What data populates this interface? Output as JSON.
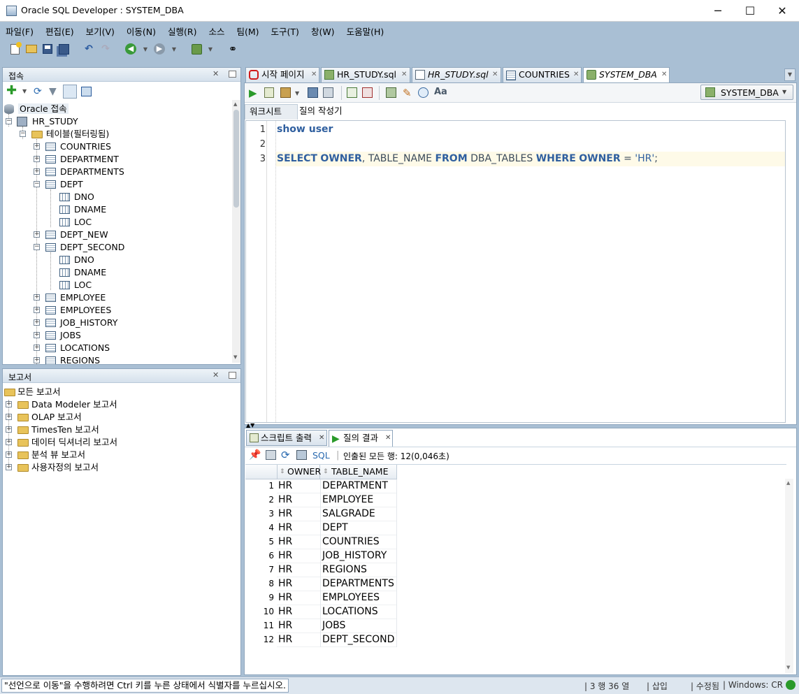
{
  "window": {
    "title": "Oracle SQL Developer : SYSTEM_DBA",
    "controls": {
      "minimize": "─",
      "maximize": "☐",
      "close": "✕"
    }
  },
  "menu": [
    "파일(F)",
    "편집(E)",
    "보기(V)",
    "이동(N)",
    "실행(R)",
    "소스",
    "팀(M)",
    "도구(T)",
    "창(W)",
    "도움말(H)"
  ],
  "connections_panel": {
    "title": "접속",
    "tree": [
      {
        "label": "Oracle 접속",
        "level": 0,
        "kind": "root"
      },
      {
        "label": "HR_STUDY",
        "level": 1,
        "kind": "connection",
        "expanded": true
      },
      {
        "label": "테이블(필터링됨)",
        "level": 2,
        "kind": "folder",
        "expanded": true
      },
      {
        "label": "COUNTRIES",
        "level": 3,
        "kind": "table"
      },
      {
        "label": "DEPARTMENT",
        "level": 3,
        "kind": "table"
      },
      {
        "label": "DEPARTMENTS",
        "level": 3,
        "kind": "table"
      },
      {
        "label": "DEPT",
        "level": 3,
        "kind": "table",
        "expanded": true
      },
      {
        "label": "DNO",
        "level": 4,
        "kind": "column"
      },
      {
        "label": "DNAME",
        "level": 4,
        "kind": "column"
      },
      {
        "label": "LOC",
        "level": 4,
        "kind": "column"
      },
      {
        "label": "DEPT_NEW",
        "level": 3,
        "kind": "table"
      },
      {
        "label": "DEPT_SECOND",
        "level": 3,
        "kind": "table",
        "expanded": true
      },
      {
        "label": "DNO",
        "level": 4,
        "kind": "column"
      },
      {
        "label": "DNAME",
        "level": 4,
        "kind": "column"
      },
      {
        "label": "LOC",
        "level": 4,
        "kind": "column"
      },
      {
        "label": "EMPLOYEE",
        "level": 3,
        "kind": "table"
      },
      {
        "label": "EMPLOYEES",
        "level": 3,
        "kind": "table"
      },
      {
        "label": "JOB_HISTORY",
        "level": 3,
        "kind": "table"
      },
      {
        "label": "JOBS",
        "level": 3,
        "kind": "table"
      },
      {
        "label": "LOCATIONS",
        "level": 3,
        "kind": "table"
      },
      {
        "label": "REGIONS",
        "level": 3,
        "kind": "table"
      }
    ]
  },
  "reports_panel": {
    "title": "보고서",
    "items": [
      {
        "label": "모든 보고서",
        "level": 0
      },
      {
        "label": "Data Modeler 보고서",
        "level": 1
      },
      {
        "label": "OLAP 보고서",
        "level": 1
      },
      {
        "label": "TimesTen 보고서",
        "level": 1
      },
      {
        "label": "데이터 딕셔너리 보고서",
        "level": 1
      },
      {
        "label": "분석 뷰 보고서",
        "level": 1
      },
      {
        "label": "사용자정의 보고서",
        "level": 1
      }
    ]
  },
  "editor_tabs": [
    {
      "label": "시작 페이지",
      "italic": false,
      "active": false
    },
    {
      "label": "HR_STUDY.sql",
      "italic": false,
      "active": false
    },
    {
      "label": "HR_STUDY.sql",
      "italic": true,
      "active": false
    },
    {
      "label": "COUNTRIES",
      "italic": false,
      "active": false
    },
    {
      "label": "SYSTEM_DBA",
      "italic": true,
      "active": true
    }
  ],
  "editor": {
    "connection": "SYSTEM_DBA",
    "subtabs": [
      "워크시트",
      "질의 작성기"
    ],
    "line_numbers": [
      "1",
      "2",
      "3"
    ],
    "line1": {
      "kw": "show user"
    },
    "line3": {
      "t1": "SELECT",
      "t2": "OWNER",
      "t3": ", TABLE_NAME",
      "t4": "FROM",
      "t5": "DBA_TABLES",
      "t6": "WHERE",
      "t7": "OWNER",
      "t8": "=",
      "t9": "'HR'",
      "t10": ";"
    }
  },
  "results": {
    "tabs": [
      "스크립트 출력",
      "질의 결과"
    ],
    "sql_label": "SQL",
    "fetch_status": "인출된 모든 행: 12(0,046초)",
    "columns": [
      "OWNER",
      "TABLE_NAME"
    ],
    "rows": [
      {
        "n": "1",
        "owner": "HR",
        "table": "DEPARTMENT"
      },
      {
        "n": "2",
        "owner": "HR",
        "table": "EMPLOYEE"
      },
      {
        "n": "3",
        "owner": "HR",
        "table": "SALGRADE"
      },
      {
        "n": "4",
        "owner": "HR",
        "table": "DEPT"
      },
      {
        "n": "5",
        "owner": "HR",
        "table": "COUNTRIES"
      },
      {
        "n": "6",
        "owner": "HR",
        "table": "JOB_HISTORY"
      },
      {
        "n": "7",
        "owner": "HR",
        "table": "REGIONS"
      },
      {
        "n": "8",
        "owner": "HR",
        "table": "DEPARTMENTS"
      },
      {
        "n": "9",
        "owner": "HR",
        "table": "EMPLOYEES"
      },
      {
        "n": "10",
        "owner": "HR",
        "table": "LOCATIONS"
      },
      {
        "n": "11",
        "owner": "HR",
        "table": "JOBS"
      },
      {
        "n": "12",
        "owner": "HR",
        "table": "DEPT_SECOND"
      }
    ]
  },
  "status": {
    "message": "\"선언으로 이동\"을 수행하려면 Ctrl 키를 누른 상태에서 식별자를 누르십시오.",
    "position": "3 행 36 열",
    "mode": "삽입",
    "modified": "수정됨",
    "lineend": "Windows: CR"
  },
  "colors": {
    "frame": "#a9bfd4",
    "keyword": "#2f5f9f",
    "current_line": "#fefae8"
  }
}
